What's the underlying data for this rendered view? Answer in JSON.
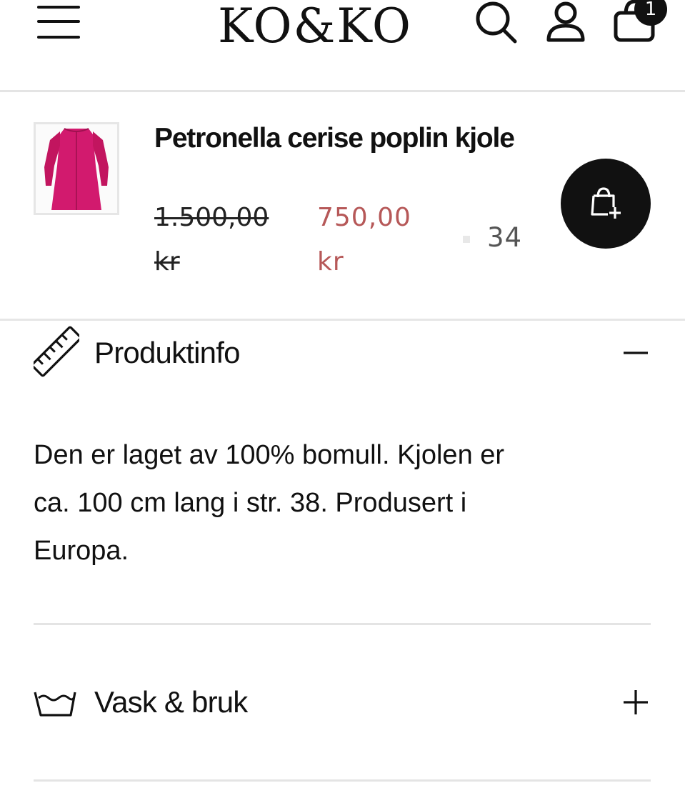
{
  "header": {
    "logo_text": "KO&KO",
    "cart_count": "1"
  },
  "product": {
    "title": "Petronella cerise poplin kjole",
    "old_price": "1.500,00 kr",
    "new_price": "750,00 kr",
    "quantity": "34",
    "thumbnail_color": "#d21a6e"
  },
  "accordion": {
    "info_label": "Produktinfo",
    "info_text": "Den er laget av 100% bomull. Kjolen er ca. 100 cm lang i str. 38. Produsert i Europa.",
    "wash_label": "Vask & bruk"
  },
  "colors": {
    "sale_price": "#b65858",
    "primary": "#111111"
  },
  "icons": [
    "menu-icon",
    "search-icon",
    "user-icon",
    "cart-icon",
    "bag-plus-icon",
    "ruler-icon",
    "minus-icon",
    "wash-tub-icon",
    "plus-icon"
  ]
}
